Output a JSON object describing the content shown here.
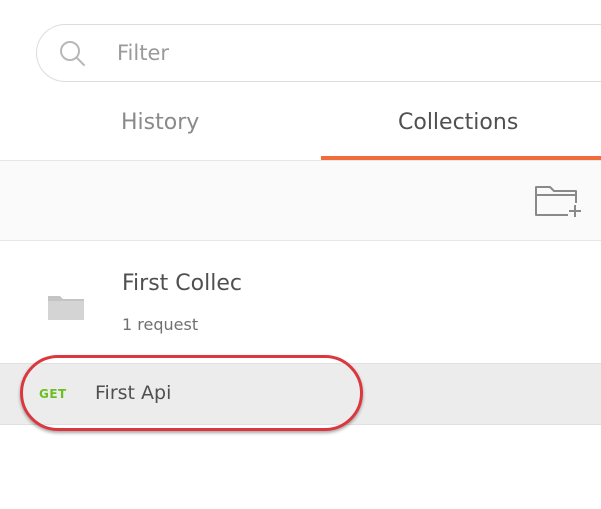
{
  "filter": {
    "placeholder": "Filter",
    "icon": "search-icon"
  },
  "tabs": [
    {
      "label": "History",
      "active": false
    },
    {
      "label": "Collections",
      "active": true
    }
  ],
  "toolbar": {
    "new_collection_icon": "new-folder-icon"
  },
  "collection": {
    "name": "First Collec",
    "meta": "1 request",
    "icon": "folder-icon"
  },
  "request": {
    "method": "GET",
    "name": "First Api"
  },
  "colors": {
    "accent": "#f26b3a",
    "method_get": "#6bbf22",
    "highlight": "#d9383f"
  }
}
